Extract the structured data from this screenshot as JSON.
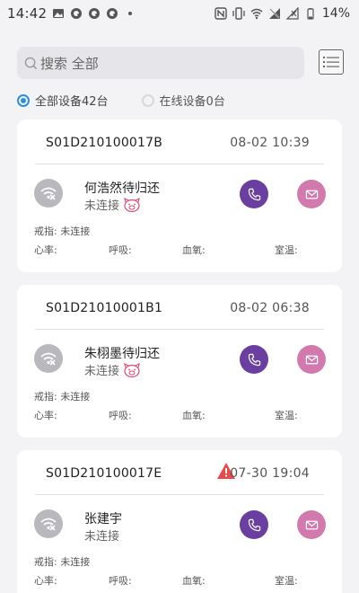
{
  "status_bar": {
    "time": "14:42",
    "battery": "14%",
    "left_icons": [
      "image-icon",
      "q-icon",
      "q-icon",
      "q-icon",
      "dot-icon"
    ],
    "right_icons": [
      "nfc-icon",
      "vibrate-icon",
      "wifi-icon",
      "no-sim-icon",
      "signal-icon",
      "battery-icon"
    ]
  },
  "search": {
    "placeholder": "搜索 全部",
    "list_icon": "list-icon"
  },
  "filters": {
    "all_label": "全部设备42台",
    "online_label": "在线设备0台",
    "selected": "all"
  },
  "colors": {
    "accent_blue": "#2f8fd8",
    "call_purple": "#6b3fa0",
    "mail_pink": "#d27aae",
    "offline_gray": "#b8b8bd",
    "alert_red": "#e84b4b"
  },
  "devices": [
    {
      "serial": "S01D210100017B",
      "time": "08-02 10:39",
      "alert": false,
      "name": "何浩然待归还",
      "status": "未连接",
      "badge": "pig-icon",
      "ring": "戒指: 未连接",
      "heart": "心率:",
      "breath": "呼吸:",
      "oxygen": "血氧:",
      "room_temp": "室温:"
    },
    {
      "serial": "S01D21010001B1",
      "time": "08-02 06:38",
      "alert": false,
      "name": "朱栩墨待归还",
      "status": "未连接",
      "badge": "pig-icon",
      "ring": "戒指: 未连接",
      "heart": "心率:",
      "breath": "呼吸:",
      "oxygen": "血氧:",
      "room_temp": "室温:"
    },
    {
      "serial": "S01D210100017E",
      "time": "07-30 19:04",
      "alert": true,
      "name": "张建宇",
      "status": "未连接",
      "badge": "",
      "ring": "戒指: 未连接",
      "heart": "心率:",
      "breath": "呼吸:",
      "oxygen": "血氧:",
      "room_temp": "室温:"
    }
  ]
}
